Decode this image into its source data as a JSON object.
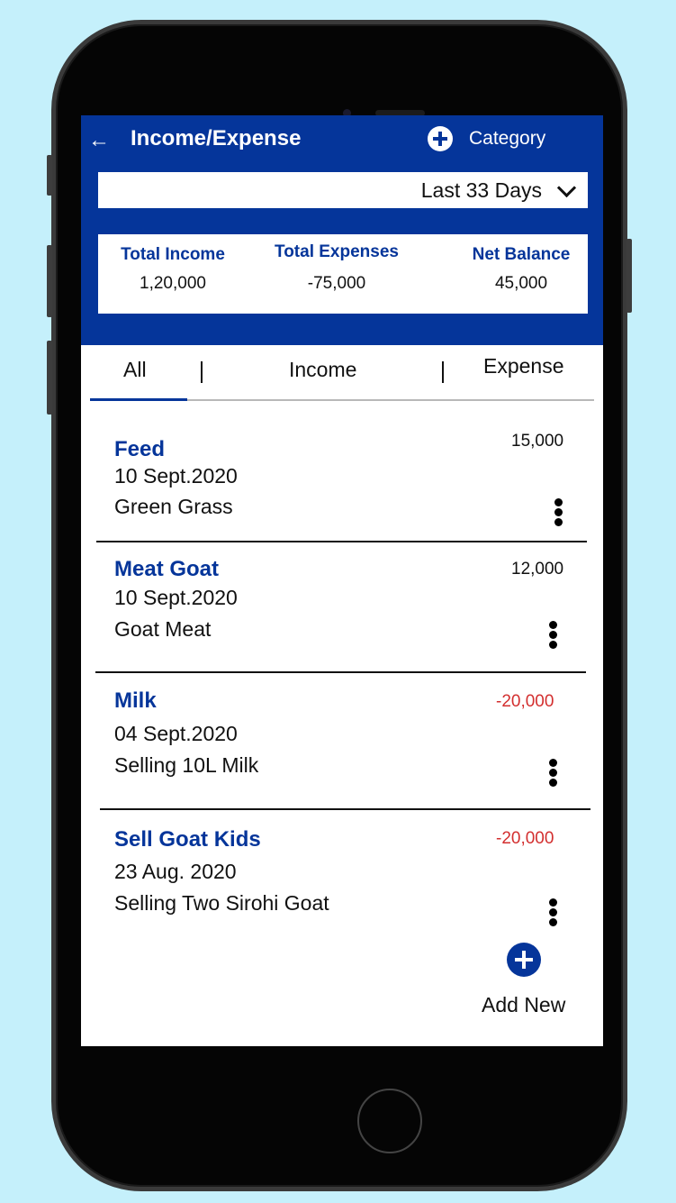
{
  "header": {
    "back_icon": "←",
    "title": "Income/Expense",
    "category_label": "Category"
  },
  "filter": {
    "selected_range": "Last 33 Days"
  },
  "summary": {
    "total_income_label": "Total Income",
    "total_income_value": "1,20,000",
    "total_expenses_label": "Total Expenses",
    "total_expenses_value": "-75,000",
    "net_balance_label": "Net Balance",
    "net_balance_value": "45,000"
  },
  "tabs": [
    {
      "label": "All",
      "active": true
    },
    {
      "label": "Income",
      "active": false
    },
    {
      "label": "Expense",
      "active": false
    }
  ],
  "transactions": [
    {
      "name": "Feed",
      "date": "10 Sept.2020",
      "description": "Green Grass",
      "amount": "15,000",
      "negative": false
    },
    {
      "name": "Meat Goat",
      "date": "10 Sept.2020",
      "description": "Goat Meat",
      "amount": "12,000",
      "negative": false
    },
    {
      "name": "Milk",
      "date": "04 Sept.2020",
      "description": "Selling 10L Milk",
      "amount": "-20,000",
      "negative": true
    },
    {
      "name": "Sell Goat Kids",
      "date": "23 Aug. 2020",
      "description": "Selling Two Sirohi Goat",
      "amount": "-20,000",
      "negative": true
    }
  ],
  "add_new_label": "Add New",
  "colors": {
    "brand_blue": "#05359a",
    "negative_red": "#d32f2f",
    "background": "#c5f0fb"
  }
}
